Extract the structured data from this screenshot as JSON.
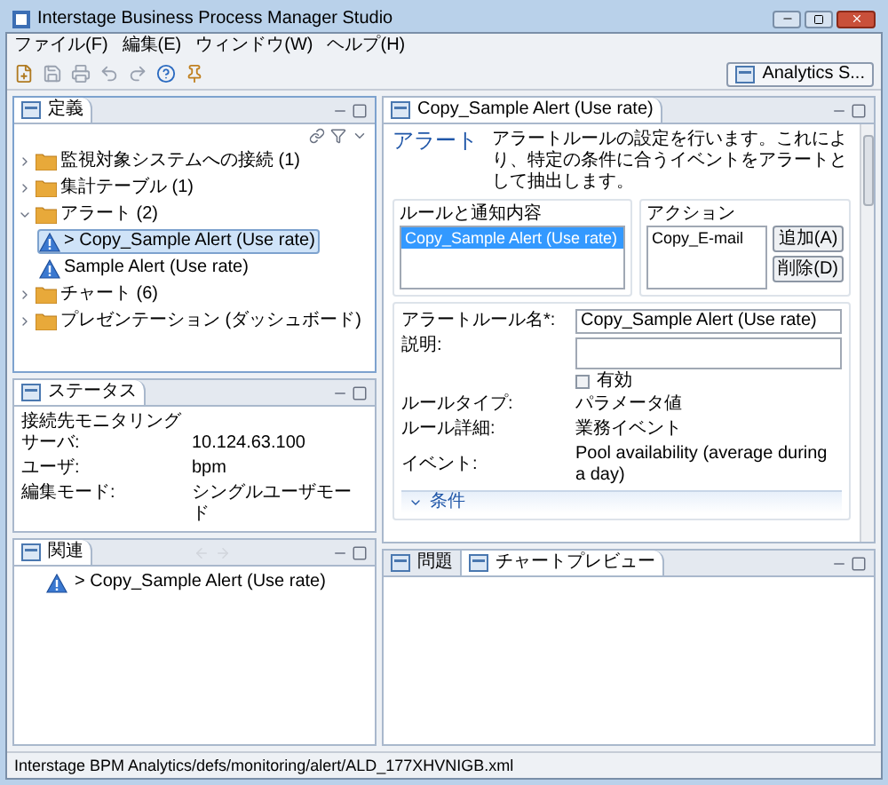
{
  "window": {
    "title": "Interstage Business Process Manager Studio"
  },
  "menu": [
    "ファイル(F)",
    "編集(E)",
    "ウィンドウ(W)",
    "ヘルプ(H)"
  ],
  "perspective_button": "Analytics S...",
  "definition_panel": {
    "tab": "定義",
    "tree": [
      {
        "label": "監視対象システムへの接続 (1)",
        "kind": "folder",
        "expanded": false,
        "selected": false
      },
      {
        "label": "集計テーブル (1)",
        "kind": "folder",
        "expanded": false,
        "selected": false
      },
      {
        "label": "アラート (2)",
        "kind": "folder",
        "expanded": true,
        "selected": false,
        "children": [
          {
            "label": "> Copy_Sample Alert (Use rate)",
            "kind": "alert",
            "selected": true
          },
          {
            "label": "Sample Alert (Use rate)",
            "kind": "alert",
            "selected": false
          }
        ]
      },
      {
        "label": "チャート (6)",
        "kind": "folder",
        "expanded": false,
        "selected": false
      },
      {
        "label": "プレゼンテーション (ダッシュボード)",
        "kind": "folder",
        "expanded": false,
        "selected": false
      }
    ]
  },
  "status_panel": {
    "tab": "ステータス",
    "rows": [
      {
        "label": "接続先モニタリングサーバ:",
        "value": "10.124.63.100"
      },
      {
        "label": "ユーザ:",
        "value": "bpm"
      },
      {
        "label": "編集モード:",
        "value": "シングルユーザモード"
      }
    ]
  },
  "related_panel": {
    "tab": "関連",
    "items": [
      {
        "label": "> Copy_Sample Alert (Use rate)"
      }
    ]
  },
  "editor": {
    "tab": "Copy_Sample Alert (Use rate)",
    "heading": "アラート",
    "description": "アラートルールの設定を行います。これにより、特定の条件に合うイベントをアラートとして抽出します。",
    "rules_group": {
      "title": "ルールと通知内容",
      "items": [
        {
          "label": "Copy_Sample Alert (Use rate)",
          "selected": true
        }
      ]
    },
    "actions_group": {
      "title": "アクション",
      "items": [
        {
          "label": "Copy_E-mail",
          "selected": false
        }
      ],
      "buttons": [
        "追加(A)",
        "削除(D)"
      ]
    },
    "form": {
      "name_label": "アラートルール名*:",
      "name_value": "Copy_Sample Alert (Use rate)",
      "description_label": "説明:",
      "enabled": {
        "label": "有効",
        "checked": false
      },
      "details": [
        {
          "label": "ルールタイプ:",
          "value": "パラメータ値"
        },
        {
          "label": "ルール詳細:",
          "value": "業務イベント"
        },
        {
          "label": "イベント:",
          "value": "Pool availability (average during a day)"
        }
      ],
      "section": {
        "label": "条件",
        "expanded": true
      }
    }
  },
  "bottom_tabs": [
    {
      "label": "問題",
      "selected": false
    },
    {
      "label": "チャートプレビュー",
      "selected": true
    }
  ],
  "status_bar": "Interstage BPM Analytics/defs/monitoring/alert/ALD_177XHVNIGB.xml"
}
